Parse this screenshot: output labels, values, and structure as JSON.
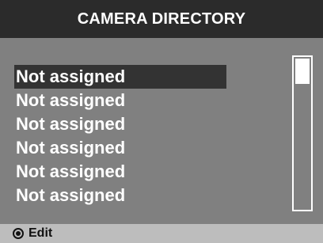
{
  "header": {
    "title": "CAMERA DIRECTORY"
  },
  "list": {
    "items": [
      {
        "label": "Not assigned",
        "selected": true
      },
      {
        "label": "Not assigned"
      },
      {
        "label": "Not assigned"
      },
      {
        "label": "Not assigned"
      },
      {
        "label": "Not assigned"
      },
      {
        "label": "Not assigned"
      }
    ]
  },
  "footer": {
    "action_icon": "knob-icon",
    "action_label": "Edit"
  },
  "colors": {
    "header_bg": "#2b2b2b",
    "screen_bg": "#808080",
    "footer_bg": "#bdbdbd",
    "selected_bg": "#333333",
    "text": "#ffffff"
  }
}
